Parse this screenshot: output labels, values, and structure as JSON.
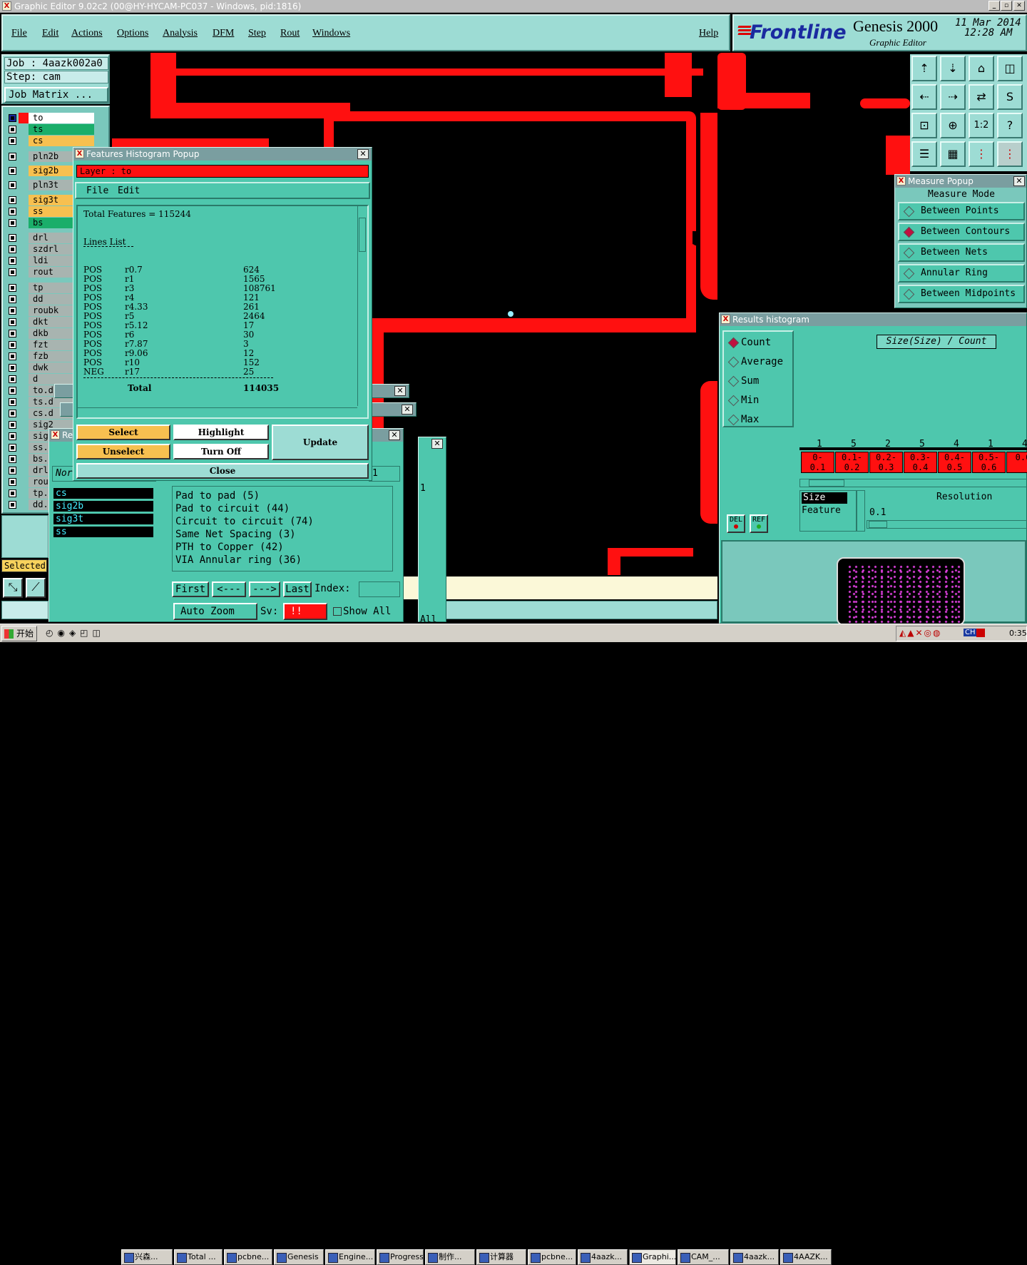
{
  "window": {
    "title": "Graphic Editor 9.02c2 (00@HY-HYCAM-PC037 - Windows, pid:1816)"
  },
  "menu": [
    "File",
    "Edit",
    "Actions",
    "Options",
    "Analysis",
    "DFM",
    "Step",
    "Rout",
    "Windows"
  ],
  "help": "Help",
  "brand": {
    "logo": "Frontline",
    "product": "Genesis 2000",
    "subtitle": "Graphic Editor",
    "date": "11 Mar 2014",
    "time": "12:28 AM"
  },
  "job": {
    "job_label": "Job : 4aazk002a0",
    "step_label": "Step: cam",
    "matrix_button": "Job Matrix ..."
  },
  "layers": [
    "to",
    "ts",
    "cs",
    "pln2b",
    "sig2b",
    "pln3t",
    "sig3t",
    "ss",
    "bs",
    "drl",
    "szdrl",
    "ldi",
    "rout",
    "tp",
    "dd",
    "roubk",
    "dkt",
    "dkb",
    "fzt",
    "fzb",
    "dwk",
    "d",
    "to.d",
    "ts.d",
    "cs.d",
    "sig2",
    "sig",
    "ss.",
    "bs.",
    "drl",
    "rou",
    "tp.",
    "dd."
  ],
  "selected_label": "Selected",
  "histogram": {
    "title": "Features Histogram Popup",
    "layer": "Layer :  to",
    "menu": [
      "File",
      "Edit"
    ],
    "total_features": "Total Features = 115244",
    "section": "Lines List",
    "rows": [
      [
        "POS",
        "r0.7",
        "624"
      ],
      [
        "POS",
        "r1",
        "1565"
      ],
      [
        "POS",
        "r3",
        "108761"
      ],
      [
        "POS",
        "r4",
        "121"
      ],
      [
        "POS",
        "r4.33",
        "261"
      ],
      [
        "POS",
        "r5",
        "2464"
      ],
      [
        "POS",
        "r5.12",
        "17"
      ],
      [
        "POS",
        "r6",
        "30"
      ],
      [
        "POS",
        "r7.87",
        "3"
      ],
      [
        "POS",
        "r9.06",
        "12"
      ],
      [
        "POS",
        "r10",
        "152"
      ],
      [
        "NEG",
        "r17",
        "25"
      ]
    ],
    "total_label": "Total",
    "total_value": "114035",
    "buttons": {
      "select": "Select",
      "highlight": "Highlight",
      "update": "Update",
      "unselect": "Unselect",
      "turn_off": "Turn Off",
      "close": "Close"
    }
  },
  "checks_window": {
    "layers": [
      "cs",
      "sig2b",
      "sig3t",
      "ss"
    ],
    "items": [
      "Pad to pad (5)",
      "Pad to circuit (44)",
      "Circuit to circuit (74)",
      "Same Net Spacing (3)",
      "PTH to Copper (42)",
      "VIA Annular ring (36)"
    ],
    "nav": {
      "first": "First",
      "prev": "<---",
      "next": "--->",
      "last": "Last",
      "index": "Index:"
    },
    "zoom": "Auto Zoom",
    "sv_label": "Sv:",
    "sv_value": "!!",
    "show_all": "Show All",
    "filter": "Nor",
    "num": "1",
    "all": "All"
  },
  "measure": {
    "title": "Measure Popup",
    "mode": "Measure Mode",
    "options": [
      "Between Points",
      "Between Contours",
      "Between Nets",
      "Annular Ring",
      "Between Midpoints"
    ],
    "selected": "Between Contours"
  },
  "results": {
    "title": "Results histogram",
    "options": [
      "Count",
      "Average",
      "Sum",
      "Min",
      "Max"
    ],
    "selected": "Count",
    "chart_title": "Size(Size) / Count",
    "counts": [
      "1",
      "5",
      "2",
      "5",
      "4",
      "1",
      "4"
    ],
    "ranges": [
      [
        "0-",
        "0.1"
      ],
      [
        "0.1-",
        "0.2"
      ],
      [
        "0.2-",
        "0.3"
      ],
      [
        "0.3-",
        "0.4"
      ],
      [
        "0.4-",
        "0.5"
      ],
      [
        "0.5-",
        "0.6"
      ],
      [
        "0.6",
        ""
      ]
    ],
    "size_label": "Size",
    "feature_label": "Feature",
    "resolution_label": "Resolution",
    "resolution_value": "0.1",
    "del": "DEL",
    "ref": "REF"
  },
  "taskbar": {
    "start": "开始",
    "tasks": [
      "兴森...",
      "Total ...",
      "pcbne...",
      "Genesis",
      "Engine...",
      "Progress",
      "制作...",
      "计算器",
      "pcbne...",
      "4aazk...",
      "Graphi...",
      "CAM_...",
      "4aazk...",
      "4AAZK..."
    ],
    "clock": "0:35",
    "ime": "CH"
  },
  "colors": {
    "panel": "#9ddcd4",
    "popup": "#4ec7ad",
    "copper": "#ff1010",
    "canvas": "#000000"
  }
}
